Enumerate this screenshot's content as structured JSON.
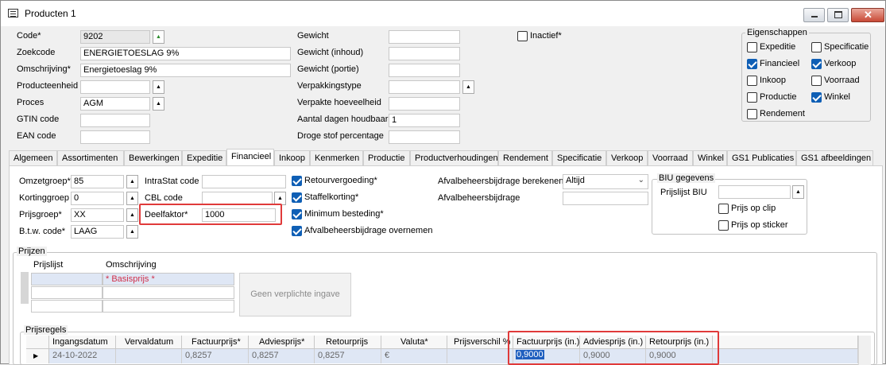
{
  "window": {
    "title": "Producten 1"
  },
  "header": {
    "code_label": "Code*",
    "code_value": "9202",
    "zoekcode_label": "Zoekcode",
    "zoekcode_value": "ENERGIETOESLAG 9%",
    "omschrijving_label": "Omschrijving*",
    "omschrijving_value": "Energietoeslag 9%",
    "producteenheid_label": "Producteenheid",
    "producteenheid_value": "",
    "proces_label": "Proces",
    "proces_value": "AGM",
    "gtin_label": "GTIN code",
    "gtin_value": "",
    "ean_label": "EAN code",
    "ean_value": "",
    "gewicht_label": "Gewicht",
    "gewicht_value": "",
    "gewicht_inhoud_label": "Gewicht (inhoud)",
    "gewicht_inhoud_value": "",
    "gewicht_portie_label": "Gewicht (portie)",
    "gewicht_portie_value": "",
    "verpakkingstype_label": "Verpakkingstype",
    "verpakkingstype_value": "",
    "verpakte_hoeveelheid_label": "Verpakte hoeveelheid",
    "verpakte_hoeveelheid_value": "",
    "houdbaar_label": "Aantal dagen houdbaar",
    "houdbaar_value": "1",
    "droge_stof_label": "Droge stof percentage",
    "droge_stof_value": "",
    "inactief_label": "Inactief*",
    "inactief_checked": false
  },
  "eigenschappen": {
    "title": "Eigenschappen",
    "items": [
      {
        "label": "Expeditie",
        "checked": false
      },
      {
        "label": "Specificatie",
        "checked": false
      },
      {
        "label": "Financieel",
        "checked": true
      },
      {
        "label": "Verkoop",
        "checked": true
      },
      {
        "label": "Inkoop",
        "checked": false
      },
      {
        "label": "Voorraad",
        "checked": false
      },
      {
        "label": "Productie",
        "checked": false
      },
      {
        "label": "Winkel",
        "checked": true
      },
      {
        "label": "Rendement",
        "checked": false
      }
    ]
  },
  "tabs": [
    "Algemeen",
    "Assortimenten",
    "Bewerkingen",
    "Expeditie",
    "Financieel",
    "Inkoop",
    "Kenmerken",
    "Productie",
    "Productverhoudingen",
    "Rendement",
    "Specificatie",
    "Verkoop",
    "Voorraad",
    "Winkel",
    "GS1 Publicaties",
    "GS1 afbeeldingen"
  ],
  "active_tab": "Financieel",
  "financieel": {
    "omzetgroep_label": "Omzetgroep*",
    "omzetgroep_value": "85",
    "kortinggroep_label": "Kortinggroep",
    "kortinggroep_value": "0",
    "prijsgroep_label": "Prijsgroep*",
    "prijsgroep_value": "XX",
    "btw_label": "B.t.w. code*",
    "btw_value": "LAAG",
    "intrastat_label": "IntraStat code",
    "intrastat_value": "",
    "cbl_label": "CBL code",
    "cbl_value": "",
    "deelfaktor_label": "Deelfaktor*",
    "deelfaktor_value": "1000",
    "retourvergoeding_label": "Retourvergoeding*",
    "staffelkorting_label": "Staffelkorting*",
    "minimum_besteding_label": "Minimum besteding*",
    "afvalbeheer_overnemen_label": "Afvalbeheersbijdrage overnemen",
    "afvalbeheer_berekenen_label": "Afvalbeheersbijdrage berekenen",
    "afvalbeheer_berekenen_value": "Altijd",
    "afvalbeheer_label": "Afvalbeheersbijdrage",
    "afvalbeheer_value": ""
  },
  "biu": {
    "title": "BIU gegevens",
    "prijslijst_label": "Prijslijst BIU",
    "prijslijst_value": "",
    "prijs_op_clip_label": "Prijs op clip",
    "prijs_op_sticker_label": "Prijs op sticker"
  },
  "prijzen": {
    "title": "Prijzen",
    "col_prijslijst": "Prijslijst",
    "col_omschrijving": "Omschrijving",
    "basisprijs": "* Basisprijs *",
    "geen_verplichte_ingave": "Geen verplichte ingave"
  },
  "prijsregels": {
    "title": "Prijsregels",
    "columns": [
      "Ingangsdatum",
      "Vervaldatum",
      "Factuurprijs*",
      "Adviesprijs*",
      "Retourprijs",
      "Valuta*",
      "Prijsverschil %",
      "Factuurprijs (in.)",
      "Adviesprijs (in.)",
      "Retourprijs (in.)"
    ],
    "row": {
      "ingangsdatum": "24-10-2022",
      "vervaldatum": "",
      "factuurprijs": "0,8257",
      "adviesprijs": "0,8257",
      "retourprijs": "0,8257",
      "valuta": "€",
      "prijsverschil": "",
      "factuurprijs_in": "0,9000",
      "adviesprijs_in": "0,9000",
      "retourprijs_in": "0,9000"
    }
  },
  "colors": {
    "highlight_red": "#e03a3a",
    "checkbox_blue": "#0f5fb5",
    "row_selected": "#dfe7f5"
  }
}
